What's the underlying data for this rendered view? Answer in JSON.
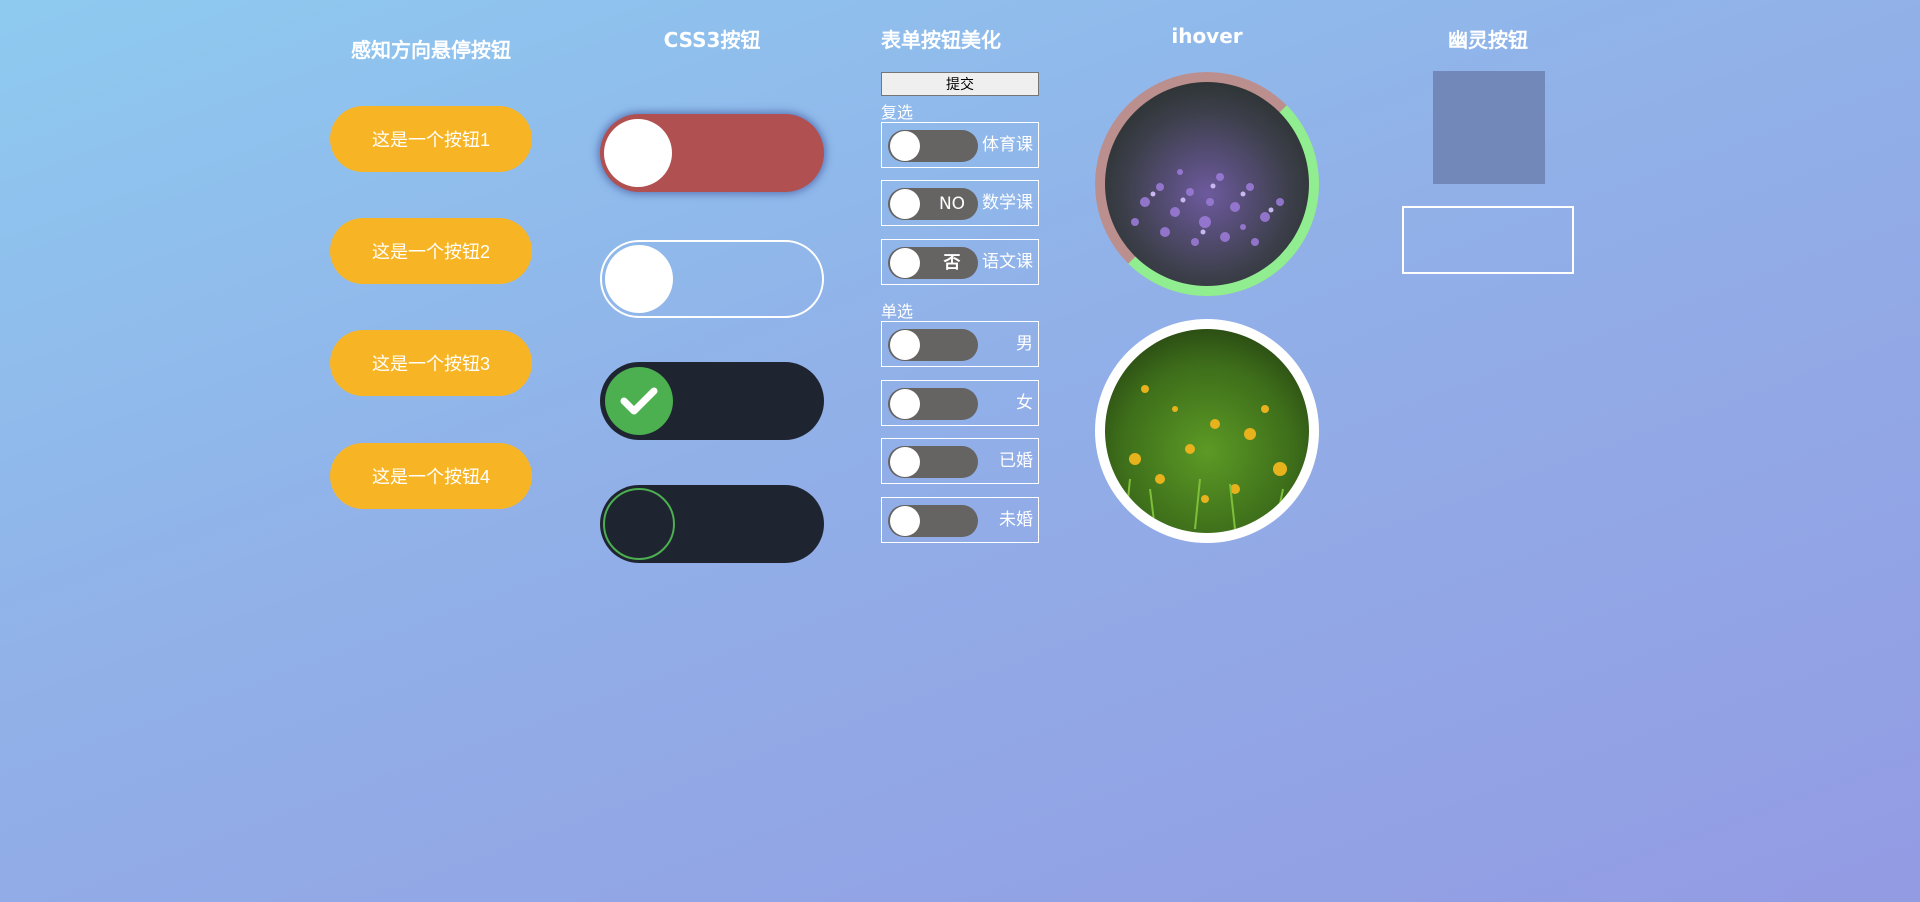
{
  "columns": {
    "direction_hover": {
      "title": "感知方向悬停按钮",
      "buttons": [
        "这是一个按钮1",
        "这是一个按钮2",
        "这是一个按钮3",
        "这是一个按钮4"
      ]
    },
    "css3": {
      "title": "CSS3按钮"
    },
    "form": {
      "title": "表单按钮美化",
      "submit_label": "提交",
      "checkbox_section": "复选",
      "checkboxes": [
        {
          "label": "体育课",
          "switch_text": ""
        },
        {
          "label": "数学课",
          "switch_text": "NO"
        },
        {
          "label": "语文课",
          "switch_text": "否"
        }
      ],
      "radio_section": "单选",
      "radios": [
        {
          "label": "男"
        },
        {
          "label": "女"
        },
        {
          "label": "已婚"
        },
        {
          "label": "未婚"
        }
      ]
    },
    "ihover": {
      "title": "ihover"
    },
    "ghost": {
      "title": "幽灵按钮"
    }
  },
  "colors": {
    "button_orange": "#f7b526",
    "toggle_red": "#b05050",
    "toggle_dark": "#1e2430",
    "check_green": "#4caf50",
    "ring_green": "#90ee90",
    "ring_mauve": "#bc8f8f",
    "switch_gray": "#666363",
    "ghost_square": "#7288b8"
  }
}
